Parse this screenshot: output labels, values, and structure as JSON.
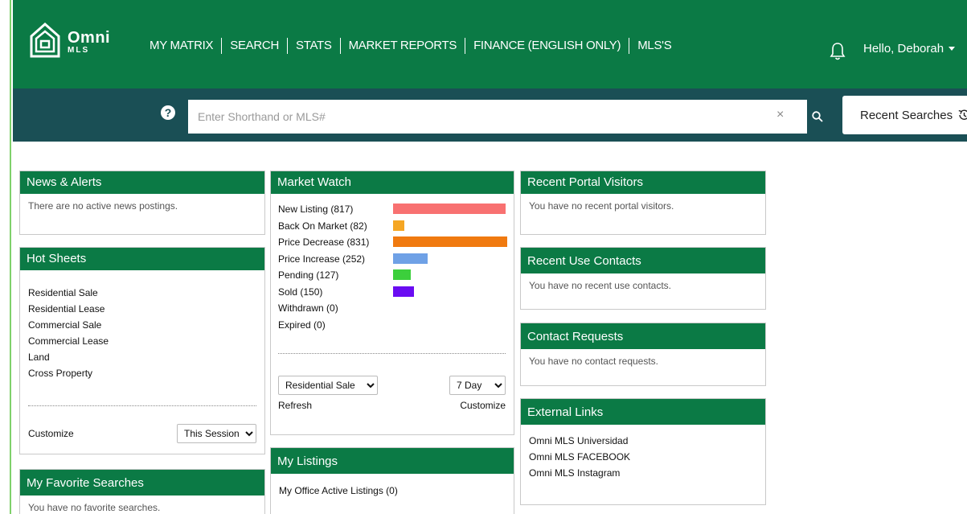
{
  "brand": {
    "word": "Omni",
    "sub": "MLS"
  },
  "nav": {
    "items": [
      {
        "label": "MY MATRIX",
        "active": true
      },
      {
        "label": "SEARCH"
      },
      {
        "label": "STATS"
      },
      {
        "label": "MARKET REPORTS"
      },
      {
        "label": "FINANCE (ENGLISH ONLY)"
      },
      {
        "label": "MLS'S"
      }
    ],
    "user_greeting": "Hello, Deborah",
    "bell_icon": "bell-icon"
  },
  "search": {
    "help_symbol": "?",
    "placeholder": "Enter Shorthand or MLS#",
    "clear_symbol": "×",
    "recent_label": "Recent Searches",
    "recent_icon": "history-icon"
  },
  "colors": {
    "brand_green": "#0b7a45",
    "search_bar": "#1a4f55"
  },
  "news": {
    "title": "News & Alerts",
    "message": "There are no active news postings."
  },
  "hot_sheets": {
    "title": "Hot Sheets",
    "items": [
      "Residential Sale",
      "Residential Lease",
      "Commercial Sale",
      "Commercial Lease",
      "Land",
      "Cross Property"
    ],
    "customize": "Customize",
    "range_selected": "This Session"
  },
  "favorites": {
    "title": "My Favorite Searches",
    "message": "You have no favorite searches."
  },
  "market_watch": {
    "title": "Market Watch",
    "rows": [
      {
        "label": "New Listing (817)",
        "count": 817,
        "color": "#f87171"
      },
      {
        "label": "Back On Market (82)",
        "count": 82,
        "color": "#f5a623"
      },
      {
        "label": "Price Decrease (831)",
        "count": 831,
        "color": "#f07a10"
      },
      {
        "label": "Price Increase (252)",
        "count": 252,
        "color": "#6fa1e6"
      },
      {
        "label": "Pending (127)",
        "count": 127,
        "color": "#3ccf3c"
      },
      {
        "label": "Sold (150)",
        "count": 150,
        "color": "#6a0cf2"
      },
      {
        "label": "Withdrawn (0)",
        "count": 0,
        "color": "#999999"
      },
      {
        "label": "Expired (0)",
        "count": 0,
        "color": "#999999"
      }
    ],
    "property_type": "Residential Sale",
    "period": "7 Day",
    "refresh": "Refresh",
    "customize": "Customize"
  },
  "my_listings": {
    "title": "My Listings",
    "item": "My Office Active Listings (0)"
  },
  "portal_visitors": {
    "title": "Recent Portal Visitors",
    "message": "You have no recent portal visitors."
  },
  "recent_contacts": {
    "title": "Recent Use Contacts",
    "message": "You have no recent use contacts."
  },
  "contact_requests": {
    "title": "Contact Requests",
    "message": "You have no contact requests."
  },
  "external_links": {
    "title": "External Links",
    "items": [
      "Omni MLS Universidad",
      "Omni MLS FACEBOOK",
      "Omni MLS Instagram"
    ]
  }
}
